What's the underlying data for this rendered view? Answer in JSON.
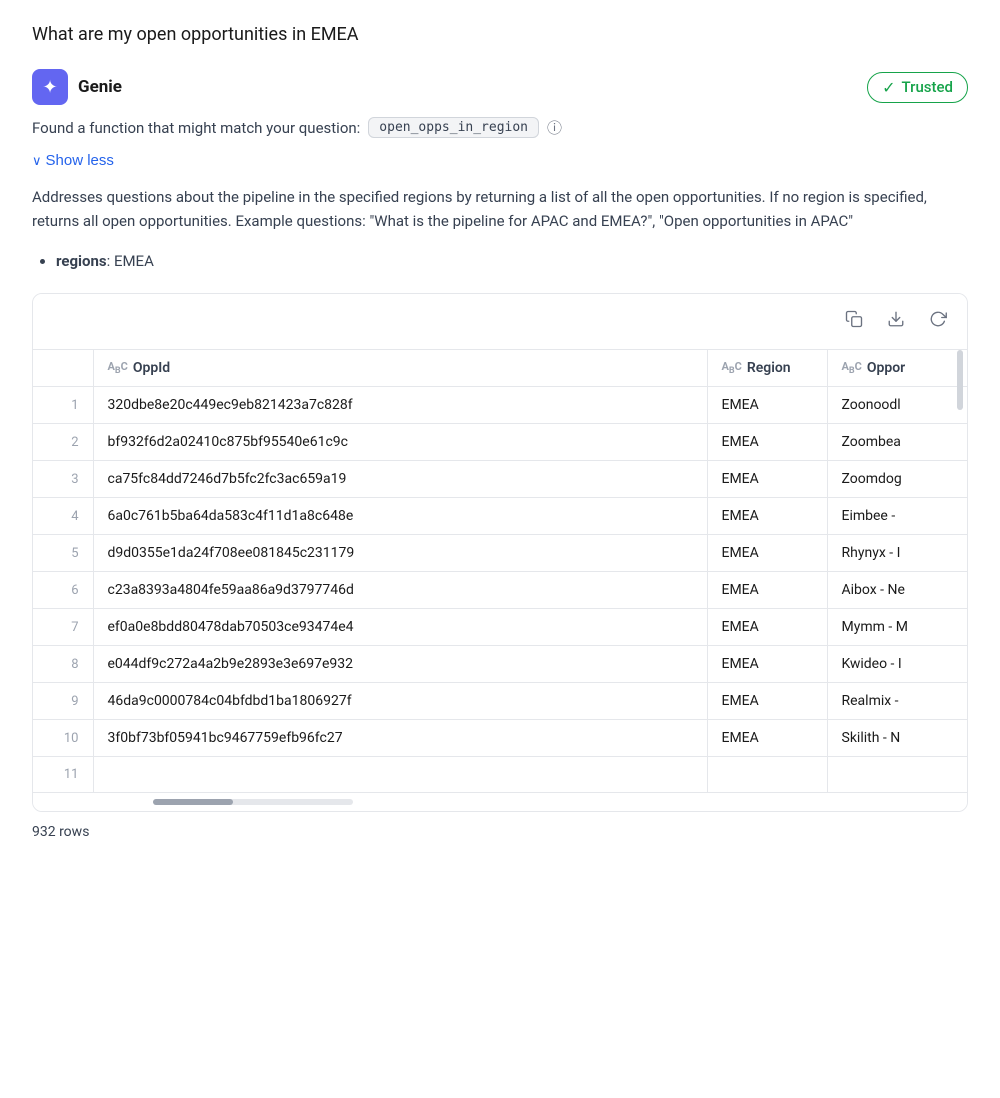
{
  "page": {
    "question": "What are my open opportunities in EMEA"
  },
  "genie": {
    "name": "Genie",
    "icon_symbol": "✦",
    "trusted_label": "Trusted",
    "function_prefix": "Found a function that might match your question:",
    "function_name": "open_opps_in_region",
    "show_less_label": "Show less",
    "description": "Addresses questions about the pipeline in the specified regions by returning a list of all the open opportunities. If no region is specified, returns all open opportunities. Example questions: \"What is the pipeline for APAC and EMEA?\", \"Open opportunities in APAC\"",
    "param_label": "regions",
    "param_value": "EMEA"
  },
  "table": {
    "copy_tooltip": "Copy",
    "download_tooltip": "Download",
    "refresh_tooltip": "Refresh",
    "columns": [
      {
        "id": "row_num",
        "label": ""
      },
      {
        "id": "oppid",
        "label": "OppId",
        "type_icon": "AB"
      },
      {
        "id": "region",
        "label": "Region",
        "type_icon": "AB"
      },
      {
        "id": "opport",
        "label": "Oppor",
        "type_icon": "AB"
      }
    ],
    "rows": [
      {
        "num": "1",
        "oppid": "320dbe8e20c449ec9eb821423a7c828f",
        "region": "EMEA",
        "opport": "Zoonoodl"
      },
      {
        "num": "2",
        "oppid": "bf932f6d2a02410c875bf95540e61c9c",
        "region": "EMEA",
        "opport": "Zoombea"
      },
      {
        "num": "3",
        "oppid": "ca75fc84dd7246d7b5fc2fc3ac659a19",
        "region": "EMEA",
        "opport": "Zoomdog"
      },
      {
        "num": "4",
        "oppid": "6a0c761b5ba64da583c4f11d1a8c648e",
        "region": "EMEA",
        "opport": "Eimbee -"
      },
      {
        "num": "5",
        "oppid": "d9d0355e1da24f708ee081845c231179",
        "region": "EMEA",
        "opport": "Rhynyx - I"
      },
      {
        "num": "6",
        "oppid": "c23a8393a4804fe59aa86a9d3797746d",
        "region": "EMEA",
        "opport": "Aibox - Ne"
      },
      {
        "num": "7",
        "oppid": "ef0a0e8bdd80478dab70503ce93474e4",
        "region": "EMEA",
        "opport": "Mymm - M"
      },
      {
        "num": "8",
        "oppid": "e044df9c272a4a2b9e2893e3e697e932",
        "region": "EMEA",
        "opport": "Kwideo - I"
      },
      {
        "num": "9",
        "oppid": "46da9c0000784c04bfdbd1ba1806927f",
        "region": "EMEA",
        "opport": "Realmix -"
      },
      {
        "num": "10",
        "oppid": "3f0bf73bf05941bc9467759efb96fc27",
        "region": "EMEA",
        "opport": "Skilith - N"
      }
    ],
    "next_row_num": "11",
    "rows_count": "932 rows"
  }
}
